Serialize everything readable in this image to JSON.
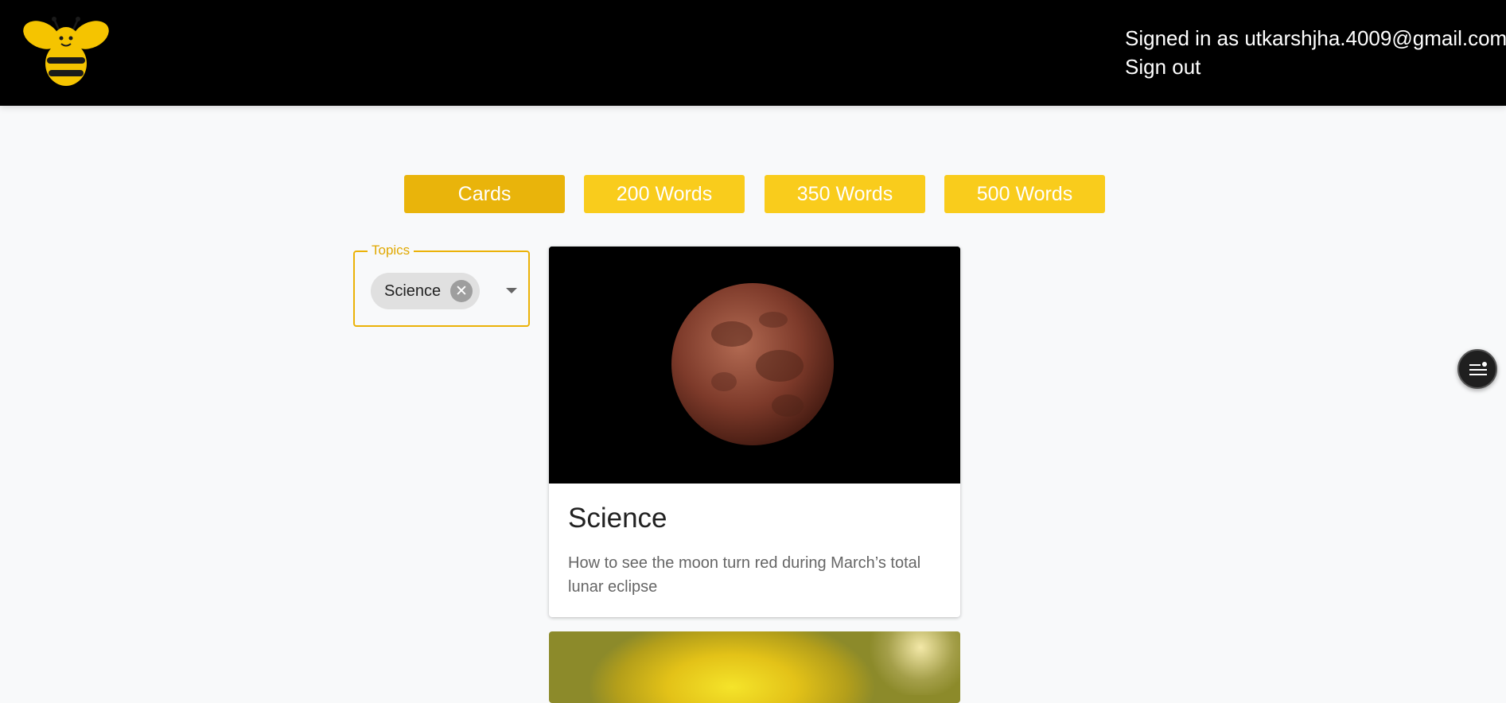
{
  "header": {
    "logo": "bee-logo",
    "signed_in_text": "Signed in as utkarshjha.4009@gmail.com",
    "sign_out_label": "Sign out"
  },
  "tabs": [
    {
      "label": "Cards",
      "active": true
    },
    {
      "label": "200 Words",
      "active": false
    },
    {
      "label": "350 Words",
      "active": false
    },
    {
      "label": "500 Words",
      "active": false
    }
  ],
  "filter": {
    "label": "Topics",
    "selected": [
      "Science"
    ],
    "chip_remove_icon": "close-circle-icon",
    "dropdown_icon": "caret-down-icon"
  },
  "cards": [
    {
      "image": "red-moon-lunar-eclipse-photo",
      "title": "Science",
      "description": "How to see the moon turn red during March’s total lunar eclipse"
    },
    {
      "image": "yellow-flower-blurred-photo"
    }
  ],
  "floating_button": {
    "icon": "filter-list-icon"
  },
  "colors": {
    "header_bg": "#000000",
    "tab_bg": "#f9cc1c",
    "tab_active_bg": "#e9b40b",
    "accent": "#ebb207",
    "page_bg": "#f8f9fa"
  }
}
